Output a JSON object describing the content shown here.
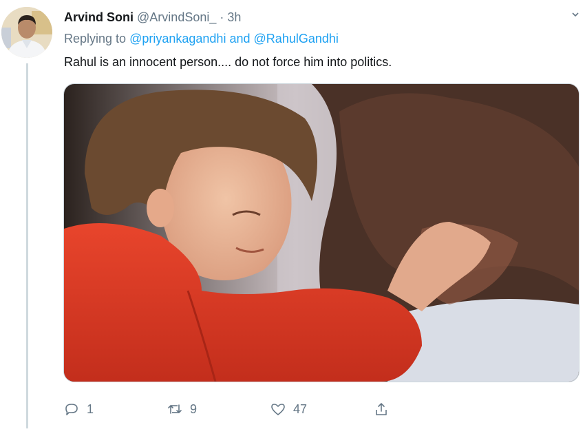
{
  "tweet": {
    "author_name": "Arvind Soni",
    "author_handle": "@ArvindSoni_",
    "separator": "·",
    "time": "3h",
    "reply_prefix": "Replying to",
    "reply_mention_1": "@priyankagandhi",
    "reply_and": "and",
    "reply_mention_2": "@RahulGandhi",
    "text": "Rahul is an innocent person.... do not force him into politics."
  },
  "actions": {
    "reply_count": "1",
    "retweet_count": "9",
    "like_count": "47"
  },
  "icons": {
    "reply": "reply-icon",
    "retweet": "retweet-icon",
    "like": "heart-icon",
    "share": "share-icon",
    "caret": "chevron-down-icon"
  },
  "colors": {
    "link": "#1da1f2",
    "secondary_text": "#657786",
    "primary_text": "#14171a"
  }
}
